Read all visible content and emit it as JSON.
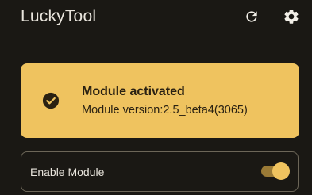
{
  "app": {
    "title": "LuckyTool"
  },
  "toolbar": {
    "refresh_icon": "refresh-icon",
    "settings_icon": "gear-icon"
  },
  "status": {
    "title": "Module activated",
    "version_text": "Module version:2.5_beta4(3065)",
    "icon": "check-circle-icon",
    "background_color": "#efc35f"
  },
  "module": {
    "label": "Enable Module",
    "enabled": true
  }
}
